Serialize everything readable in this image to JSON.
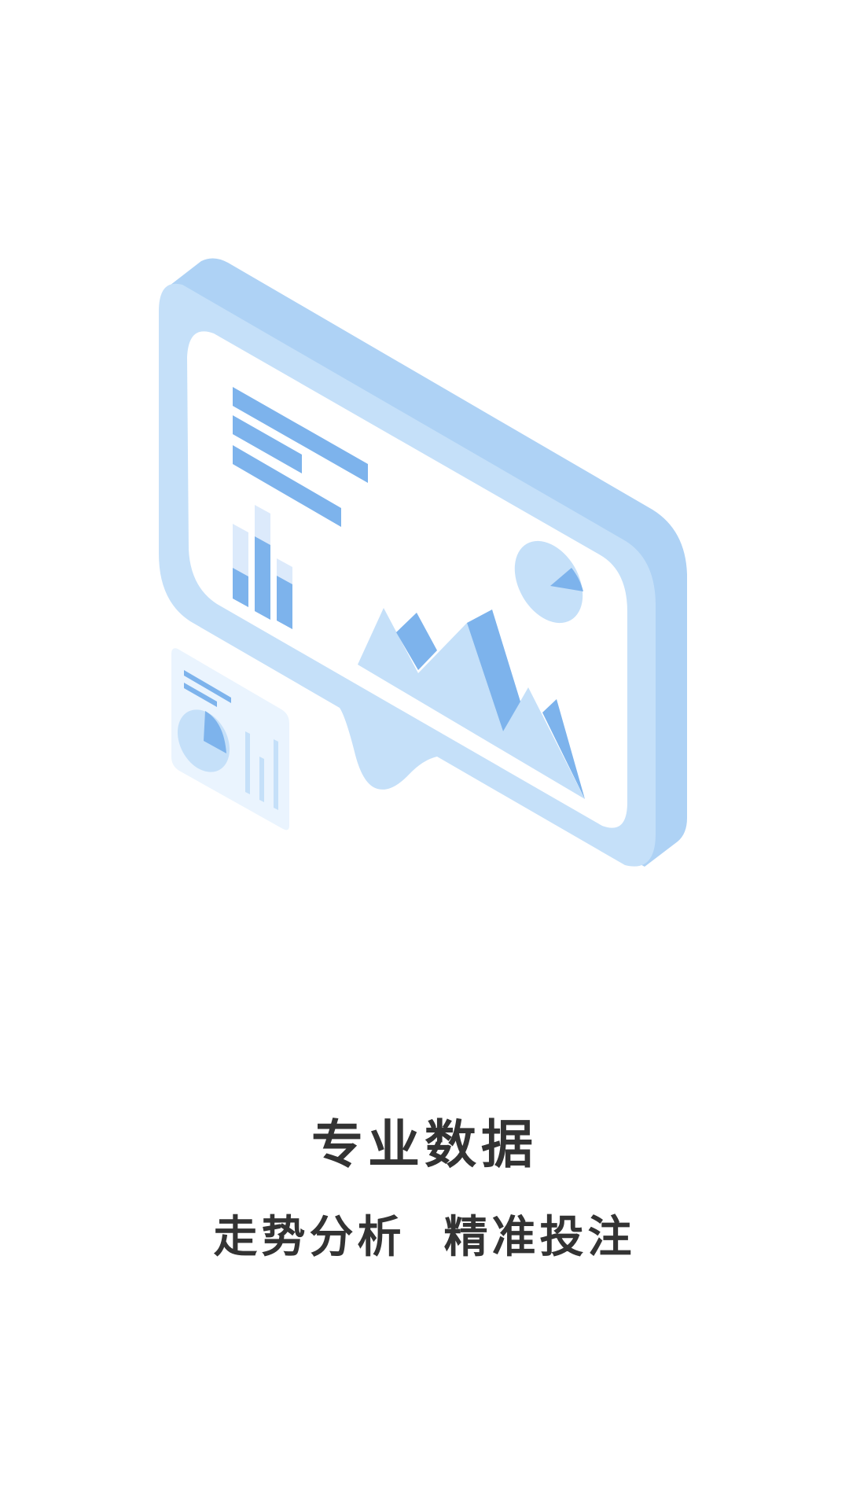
{
  "onboarding": {
    "title": "专业数据",
    "subtitle": "走势分析  精准投注"
  },
  "illustration": {
    "icon": "analytics-dashboard-illustration",
    "colors": {
      "frame_top": "#aed2f5",
      "frame_front": "#c5e0f9",
      "screen": "#ffffff",
      "accent": "#7db3ec",
      "light": "#c5e0f9",
      "pale": "#dceafb",
      "card": "#eaf4fe"
    }
  }
}
